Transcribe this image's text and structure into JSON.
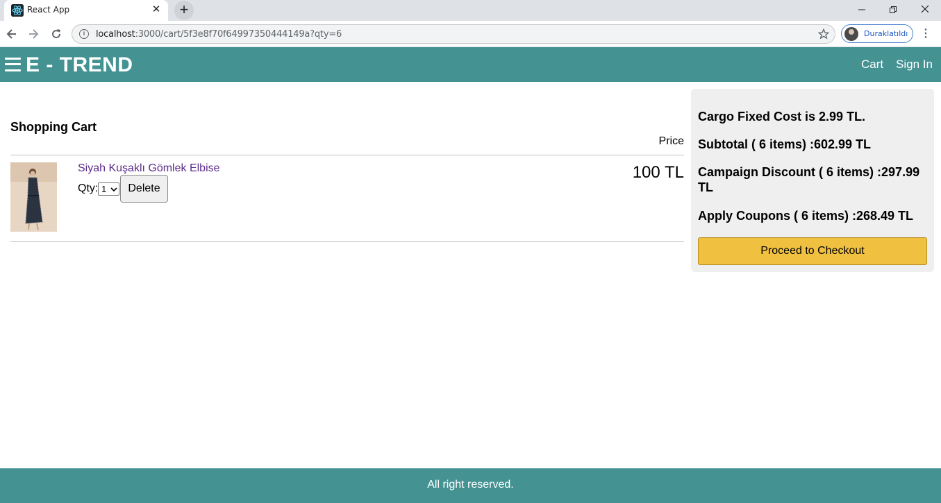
{
  "browser": {
    "tab_title": "React App",
    "tab_close_glyph": "✕",
    "new_tab_glyph": "+",
    "url_host": "localhost",
    "url_rest": ":3000/cart/5f3e8f70f64997350444149a?qty=6",
    "profile_label": "Duraklatıldı",
    "icons": [
      "react-favicon",
      "back-icon",
      "forward-icon",
      "reload-icon",
      "info-icon",
      "star-icon",
      "menu-dots-icon"
    ]
  },
  "header": {
    "brand": "E - TREND",
    "nav": {
      "cart": "Cart",
      "sign_in": "Sign In"
    },
    "accent_color": "#459293"
  },
  "cart": {
    "title": "Shopping Cart",
    "price_header": "Price",
    "items": [
      {
        "name": "Siyah Kuşaklı Gömlek Elbise",
        "qty_label": "Qty:",
        "qty_value": "1",
        "delete_label": "Delete",
        "price": "100 TL"
      }
    ]
  },
  "summary": {
    "cargo": "Cargo Fixed Cost is 2.99 TL.",
    "subtotal": "Subtotal ( 6 items) :602.99 TL",
    "campaign": "Campaign Discount ( 6 items) :297.99 TL",
    "coupons": "Apply Coupons ( 6 items) :268.49 TL",
    "checkout_label": "Proceed to Checkout",
    "checkout_color": "#f0c040"
  },
  "footer": {
    "text": "All right reserved."
  }
}
